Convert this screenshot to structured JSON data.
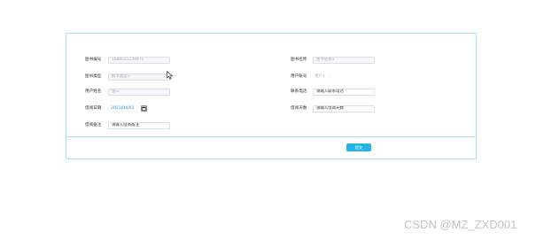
{
  "form": {
    "book_id": {
      "label": "图书编号",
      "value": "1680521139475"
    },
    "book_name": {
      "label": "图书名称",
      "placeholder": "图书名称1"
    },
    "book_type": {
      "label": "图书类型",
      "placeholder": "图书类型1"
    },
    "user_account": {
      "label": "用户账号",
      "value": "用户1"
    },
    "user_name": {
      "label": "用户姓名",
      "value": "张三"
    },
    "contact_phone": {
      "label": "联系电话",
      "placeholder": "请输入联系电话"
    },
    "borrow_date": {
      "label": "借阅日期",
      "value": "2023/04/03"
    },
    "borrow_days": {
      "label": "借阅天数",
      "placeholder": "请输入借阅天数"
    },
    "borrow_note": {
      "label": "借阅备注",
      "placeholder": "请输入借阅备注"
    },
    "submit_label": "提交"
  },
  "icons": {
    "calendar": "calendar-icon",
    "cursor": "mouse-pointer-icon",
    "dropdown": "chevron-down-icon"
  },
  "watermark": "CSDN @MZ_ZXD001",
  "colors": {
    "border": "#a8dff0",
    "primary": "#25b3e8",
    "date": "#2b8adf"
  }
}
